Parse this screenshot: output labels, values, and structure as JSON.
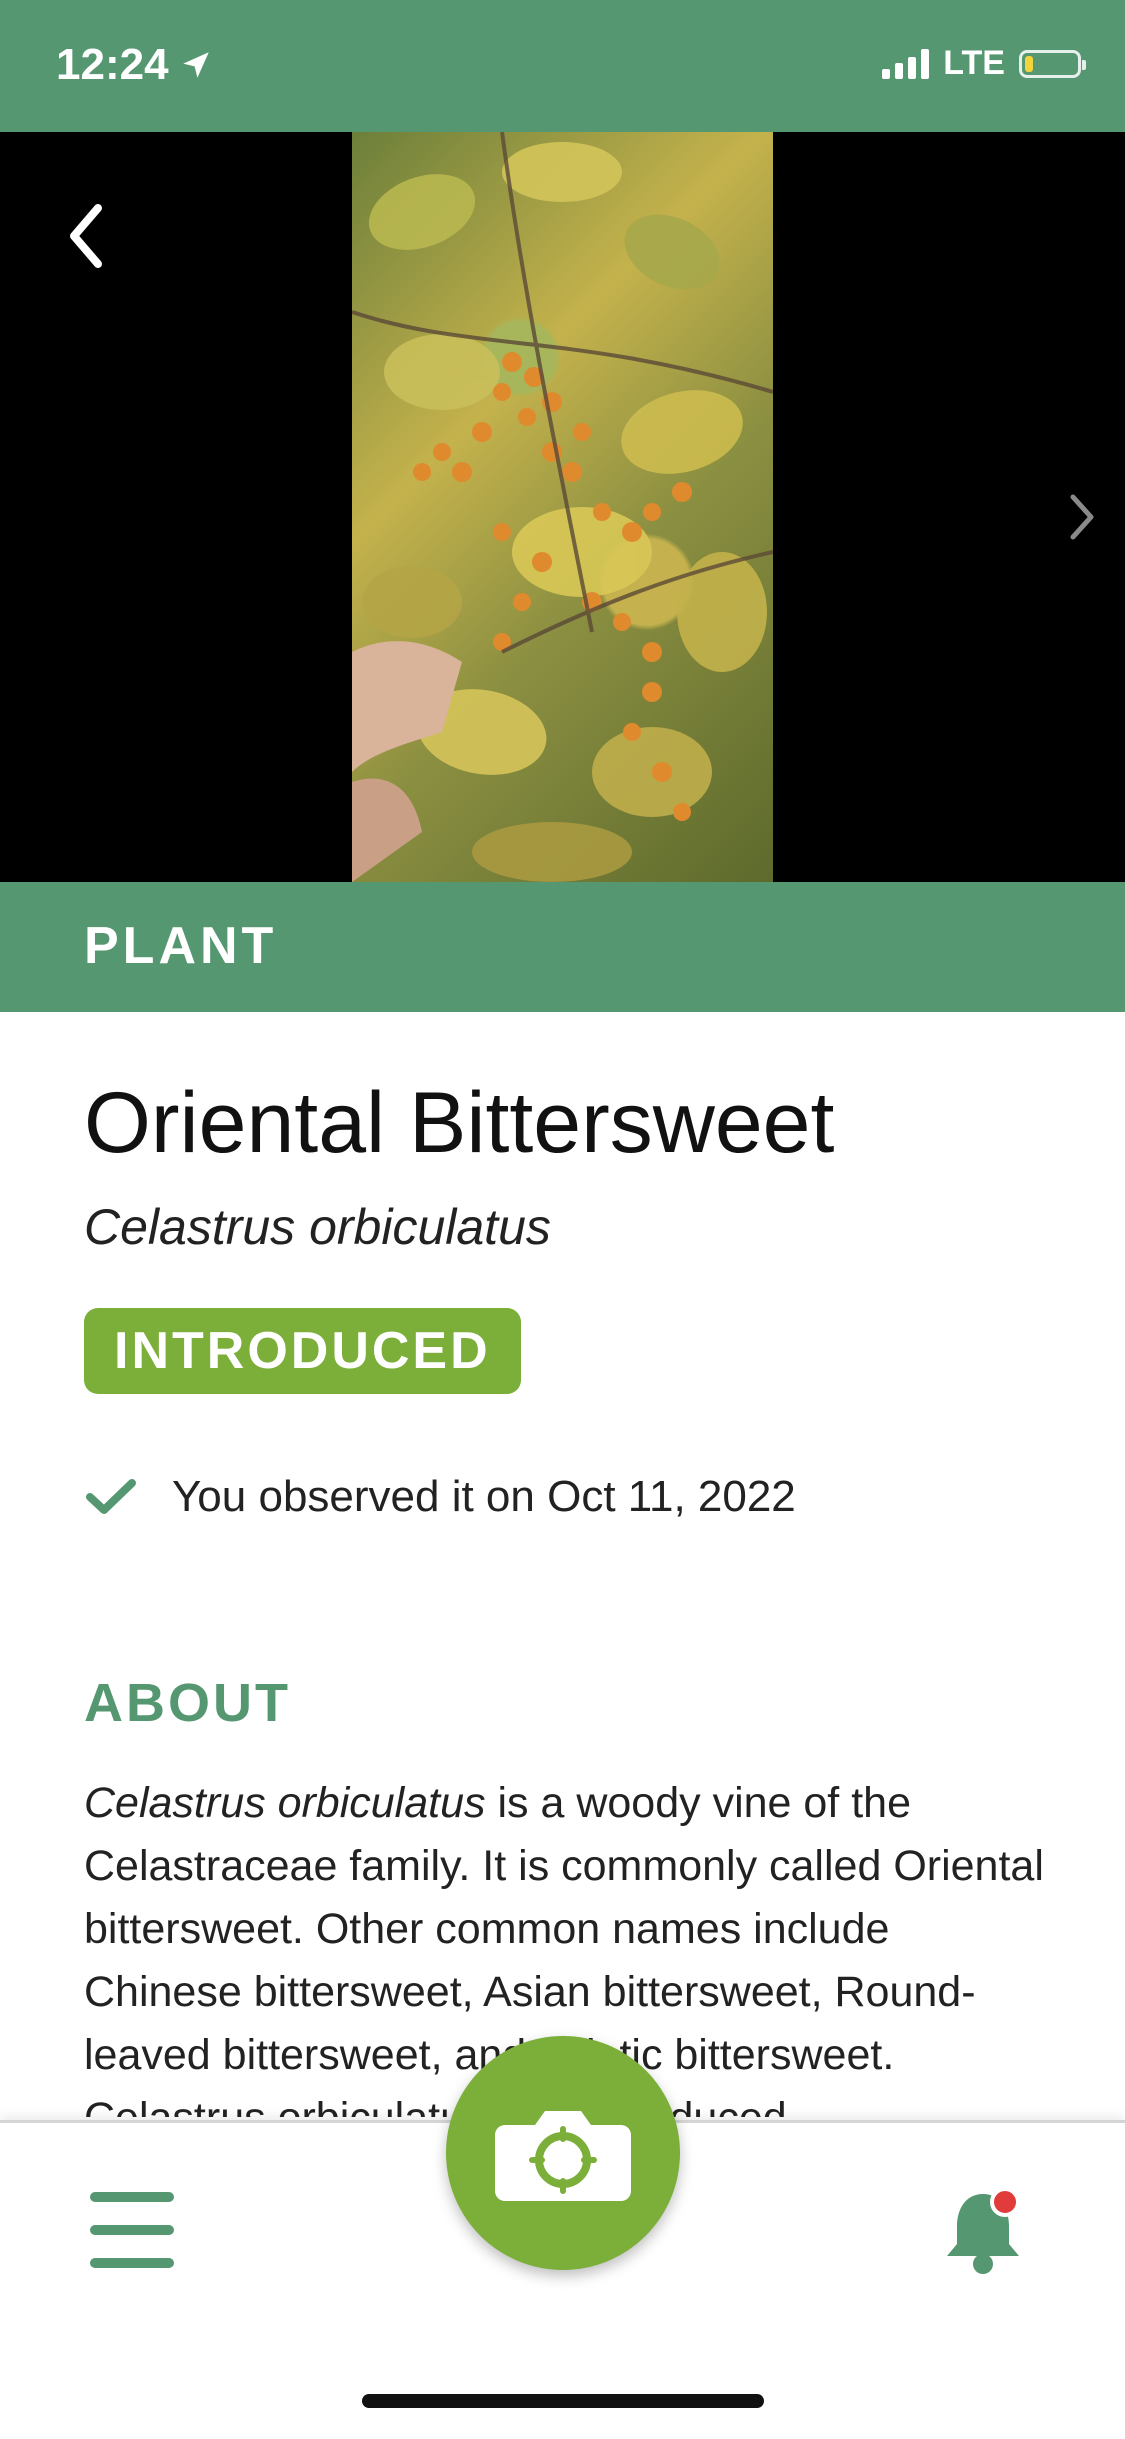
{
  "status_bar": {
    "time": "12:24",
    "network": "LTE",
    "battery_level": 0.15
  },
  "photo": {
    "alt": "Photo of Oriental Bittersweet vine with orange berries",
    "description_icon": "plant-photo"
  },
  "category": "PLANT",
  "species": {
    "common_name": "Oriental Bittersweet",
    "scientific_name": "Celastrus orbiculatus",
    "status": "INTRODUCED"
  },
  "observation": {
    "text": "You observed it on Oct 11, 2022"
  },
  "about": {
    "heading": "ABOUT",
    "lead_italic": "Celastrus orbiculatus",
    "body": " is a woody vine of the Celastraceae family. It is commonly called Oriental bittersweet. Other common names include Chinese bittersweet, Asian bittersweet, Round-leaved bittersweet, and Asiatic bittersweet. Celastrus orbiculatus was introduced"
  },
  "colors": {
    "brand_green": "#559770",
    "accent_green": "#7cae3a",
    "notification_dot": "#e23b3b"
  },
  "icons": {
    "back": "chevron-left-icon",
    "next": "chevron-right-icon",
    "check": "check-icon",
    "menu": "hamburger-icon",
    "camera": "camera-icon",
    "bell": "bell-icon"
  }
}
